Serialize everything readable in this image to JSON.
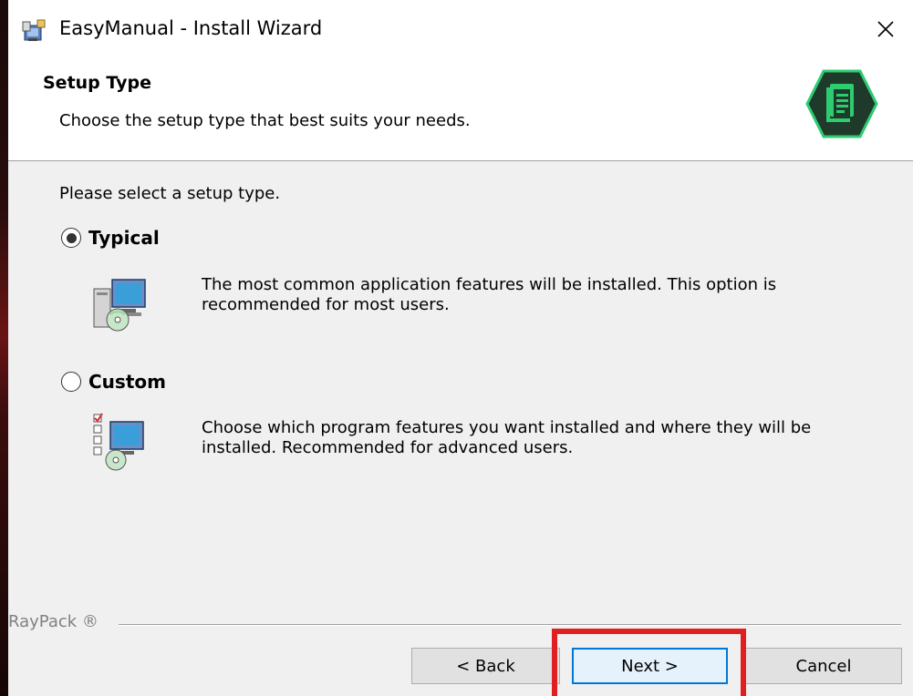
{
  "window": {
    "title": "EasyManual - Install Wizard",
    "close_symbol": "✕"
  },
  "header": {
    "title": "Setup Type",
    "subtitle": "Choose the setup type that best suits your needs."
  },
  "content": {
    "prompt": "Please select a setup type.",
    "options": [
      {
        "label": "Typical",
        "selected": true,
        "description": "The most common application features will be installed. This option is recommended for most users.",
        "icon": "typical-setup-icon"
      },
      {
        "label": "Custom",
        "selected": false,
        "description": "Choose which program features you want installed and where they will be installed. Recommended for advanced users.",
        "icon": "custom-setup-icon"
      }
    ]
  },
  "footer": {
    "brand": "RayPack ®",
    "back_label": "< Back",
    "next_label": "Next >",
    "cancel_label": "Cancel"
  },
  "colors": {
    "accent": "#0078d7",
    "highlight": "#e02020",
    "logo_green": "#2ecc71",
    "logo_dark": "#1f3a2a"
  }
}
